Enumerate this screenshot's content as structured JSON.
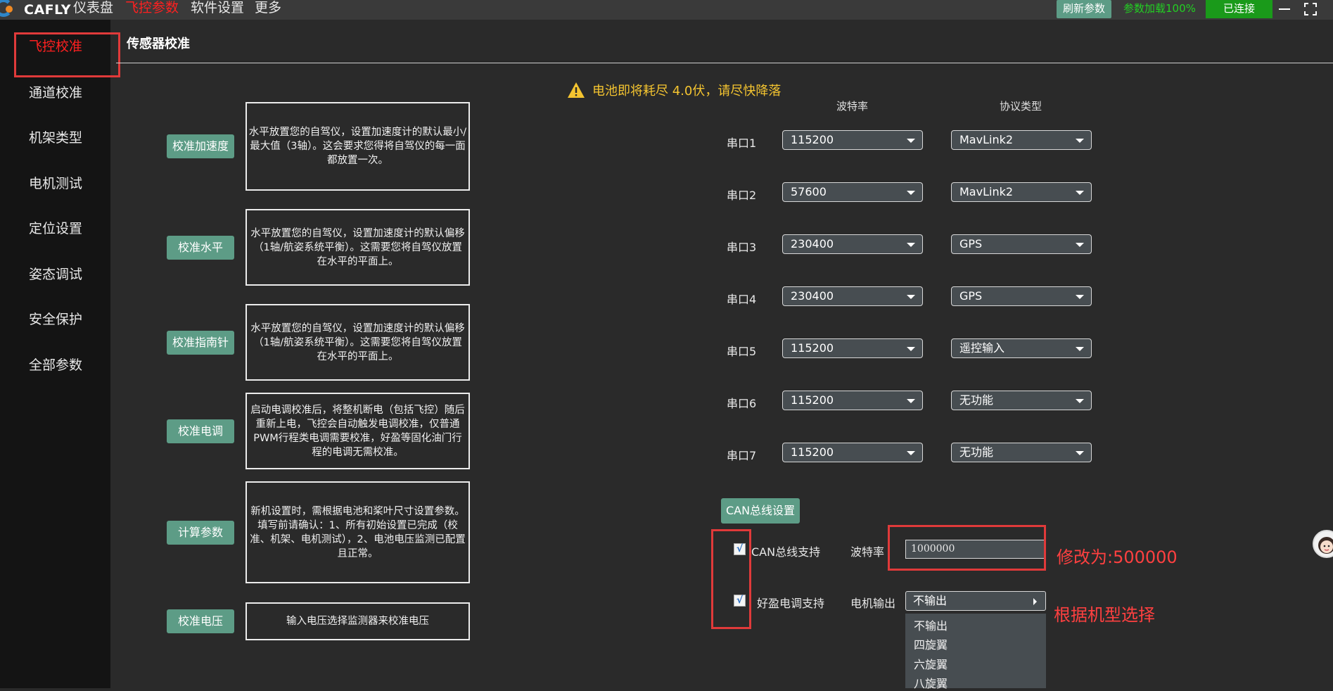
{
  "app": {
    "name": "CAFLY"
  },
  "topnav": {
    "items": [
      {
        "label": "仪表盘",
        "active": false
      },
      {
        "label": "飞控参数",
        "active": true
      },
      {
        "label": "软件设置",
        "active": false
      },
      {
        "label": "更多",
        "active": false
      }
    ],
    "refresh_label": "刷新参数",
    "load_status": "参数加载100%",
    "connected_label": "已连接",
    "window_controls": [
      "minimize-icon",
      "maximize-icon"
    ]
  },
  "sidebar": {
    "items": [
      {
        "label": "飞控校准",
        "active": true
      },
      {
        "label": "通道校准"
      },
      {
        "label": "机架类型"
      },
      {
        "label": "电机测试"
      },
      {
        "label": "定位设置"
      },
      {
        "label": "姿态调试"
      },
      {
        "label": "安全保护"
      },
      {
        "label": "全部参数"
      }
    ]
  },
  "page": {
    "title": "传感器校准"
  },
  "warning": {
    "icon": "warning-icon",
    "text": "电池即将耗尽 4.0伏，请尽快降落",
    "color": "#f4c430"
  },
  "calibrations": [
    {
      "button": "校准加速度",
      "desc": "水平放置您的自驾仪，设置加速度计的默认最小/最大值（3轴）。这会要求您得将自驾仪的每一面都放置一次。"
    },
    {
      "button": "校准水平",
      "desc": "水平放置您的自驾仪，设置加速度计的默认偏移（1轴/航姿系统平衡）。这需要您将自驾仪放置在水平的平面上。"
    },
    {
      "button": "校准指南针",
      "desc": "水平放置您的自驾仪，设置加速度计的默认偏移（1轴/航姿系统平衡）。这需要您将自驾仪放置在水平的平面上。"
    },
    {
      "button": "校准电调",
      "desc": "启动电调校准后，将整机断电（包括飞控）随后重新上电，飞控会自动触发电调校准，仅普通PWM行程类电调需要校准，好盈等固化油门行程的电调无需校准。"
    },
    {
      "button": "计算参数",
      "desc": "新机设置时，需根据电池和桨叶尺寸设置参数。填写前请确认：1、所有初始设置已完成（校准、机架、电机测试），2、电池电压监测已配置且正常。"
    },
    {
      "button": "校准电压",
      "desc": "输入电压选择监测器来校准电压"
    }
  ],
  "serial": {
    "headers": {
      "baud": "波特率",
      "protocol": "协议类型"
    },
    "ports": [
      {
        "label": "串口1",
        "baud": "115200",
        "protocol": "MavLink2"
      },
      {
        "label": "串口2",
        "baud": "57600",
        "protocol": "MavLink2"
      },
      {
        "label": "串口3",
        "baud": "230400",
        "protocol": "GPS"
      },
      {
        "label": "串口4",
        "baud": "230400",
        "protocol": "GPS"
      },
      {
        "label": "串口5",
        "baud": "115200",
        "protocol": "遥控输入"
      },
      {
        "label": "串口6",
        "baud": "115200",
        "protocol": "无功能"
      },
      {
        "label": "串口7",
        "baud": "115200",
        "protocol": "无功能"
      }
    ]
  },
  "can": {
    "section_label": "CAN总线设置",
    "can_support": {
      "label": "CAN总线支持",
      "checked": true,
      "mark": "√"
    },
    "hobbywing_support": {
      "label": "好盈电调支持",
      "checked": true,
      "mark": "√"
    },
    "baud_label": "波特率",
    "baud_value": "1000000",
    "motor_output_label": "电机输出",
    "motor_output_value": "不输出",
    "motor_output_options": [
      "不输出",
      "四旋翼",
      "六旋翼",
      "八旋翼"
    ]
  },
  "annotations": {
    "baud_note": "修改为:500000",
    "motor_note": "根据机型选择",
    "color": "#e03a3a"
  }
}
